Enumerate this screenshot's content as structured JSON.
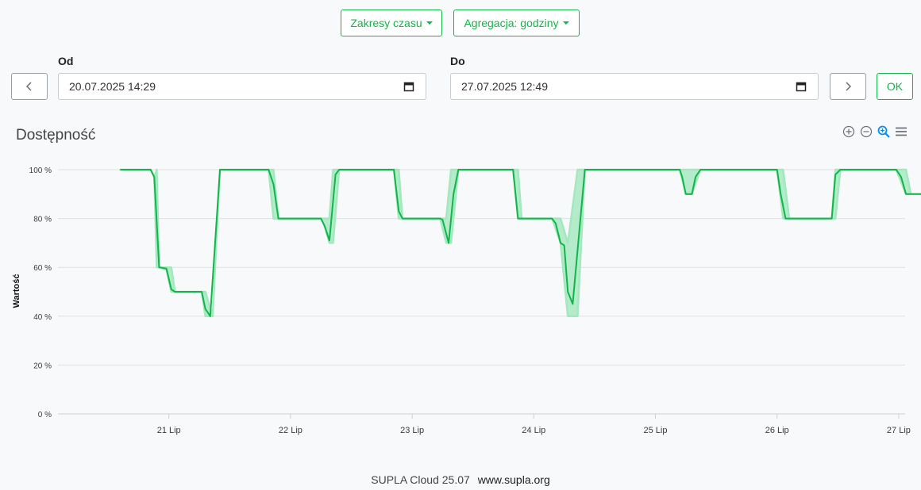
{
  "toolbar": {
    "time_ranges_label": "Zakresy czasu",
    "aggregation_label": "Agregacja: godziny"
  },
  "range": {
    "from_label": "Od",
    "from_value": "20.07.2025 14:29",
    "to_label": "Do",
    "to_value": "27.07.2025 12:49",
    "ok_label": "OK"
  },
  "chart": {
    "title": "Dostępność",
    "ylabel": "Wartość",
    "accent_color": "#12b54a",
    "band_color": "#a3e8bf"
  },
  "chart_data": {
    "type": "line",
    "title": "Dostępność",
    "xlabel": "",
    "ylabel": "Wartość",
    "x_ticks": [
      "21 Lip",
      "22 Lip",
      "23 Lip",
      "24 Lip",
      "25 Lip",
      "26 Lip",
      "27 Lip"
    ],
    "y_ticks": [
      "0 %",
      "20 %",
      "40 %",
      "60 %",
      "80 %",
      "100 %"
    ],
    "ylim": [
      0,
      100
    ],
    "x_unit": "days since 20 Lip 00:00",
    "series": [
      {
        "name": "",
        "points": [
          [
            0.6,
            100
          ],
          [
            0.85,
            100
          ],
          [
            0.88,
            97
          ],
          [
            0.92,
            60
          ],
          [
            0.98,
            59.5
          ],
          [
            1.02,
            51
          ],
          [
            1.05,
            50
          ],
          [
            1.27,
            50
          ],
          [
            1.3,
            43
          ],
          [
            1.34,
            40
          ],
          [
            1.42,
            100
          ],
          [
            1.82,
            100
          ],
          [
            1.86,
            94
          ],
          [
            1.9,
            80
          ],
          [
            2.25,
            80
          ],
          [
            2.28,
            77
          ],
          [
            2.32,
            71
          ],
          [
            2.37,
            98
          ],
          [
            2.4,
            100
          ],
          [
            2.85,
            100
          ],
          [
            2.89,
            83
          ],
          [
            2.92,
            80
          ],
          [
            3.23,
            80
          ],
          [
            3.25,
            79.5
          ],
          [
            3.3,
            70
          ],
          [
            3.34,
            90
          ],
          [
            3.38,
            100
          ],
          [
            3.83,
            100
          ],
          [
            3.87,
            80
          ],
          [
            4.15,
            80
          ],
          [
            4.18,
            78
          ],
          [
            4.22,
            70
          ],
          [
            4.25,
            69
          ],
          [
            4.28,
            50
          ],
          [
            4.32,
            45
          ],
          [
            4.36,
            67
          ],
          [
            4.42,
            100
          ],
          [
            5.2,
            100
          ],
          [
            5.22,
            97
          ],
          [
            5.25,
            90
          ],
          [
            5.3,
            90
          ],
          [
            5.33,
            97
          ],
          [
            5.37,
            100
          ],
          [
            6.0,
            100
          ],
          [
            6.03,
            90
          ],
          [
            6.07,
            80
          ],
          [
            6.45,
            80
          ],
          [
            6.48,
            98
          ],
          [
            6.52,
            100
          ],
          [
            6.98,
            100
          ],
          [
            7.02,
            97
          ],
          [
            7.06,
            90
          ],
          [
            7.45,
            90
          ],
          [
            7.49,
            82
          ],
          [
            7.53,
            80
          ],
          [
            7.58,
            80
          ]
        ],
        "band": [
          [
            0.6,
            100,
            100
          ],
          [
            0.85,
            100,
            100
          ],
          [
            0.88,
            97,
            97
          ],
          [
            0.9,
            60,
            100
          ],
          [
            0.92,
            60,
            60
          ],
          [
            0.98,
            59,
            60
          ],
          [
            1.02,
            50,
            60
          ],
          [
            1.05,
            50,
            50
          ],
          [
            1.27,
            50,
            50
          ],
          [
            1.3,
            40,
            50
          ],
          [
            1.36,
            40,
            40
          ],
          [
            1.42,
            100,
            100
          ],
          [
            1.82,
            100,
            100
          ],
          [
            1.86,
            80,
            100
          ],
          [
            1.9,
            80,
            80
          ],
          [
            2.25,
            80,
            80
          ],
          [
            2.28,
            77,
            80
          ],
          [
            2.32,
            70,
            80
          ],
          [
            2.35,
            70,
            100
          ],
          [
            2.4,
            100,
            100
          ],
          [
            2.85,
            100,
            100
          ],
          [
            2.89,
            80,
            100
          ],
          [
            2.92,
            80,
            80
          ],
          [
            3.23,
            80,
            80
          ],
          [
            3.28,
            70,
            80
          ],
          [
            3.32,
            70,
            100
          ],
          [
            3.38,
            100,
            100
          ],
          [
            3.83,
            100,
            100
          ],
          [
            3.87,
            80,
            100
          ],
          [
            3.9,
            80,
            80
          ],
          [
            4.15,
            80,
            80
          ],
          [
            4.22,
            70,
            80
          ],
          [
            4.28,
            40,
            70
          ],
          [
            4.36,
            40,
            100
          ],
          [
            4.42,
            100,
            100
          ],
          [
            5.2,
            100,
            100
          ],
          [
            5.25,
            90,
            100
          ],
          [
            5.3,
            90,
            100
          ],
          [
            5.37,
            100,
            100
          ],
          [
            6.0,
            100,
            100
          ],
          [
            6.05,
            80,
            100
          ],
          [
            6.1,
            80,
            80
          ],
          [
            6.45,
            80,
            80
          ],
          [
            6.48,
            80,
            100
          ],
          [
            6.52,
            100,
            100
          ],
          [
            6.98,
            100,
            100
          ],
          [
            7.06,
            90,
            100
          ],
          [
            7.1,
            90,
            90
          ],
          [
            7.45,
            90,
            90
          ],
          [
            7.5,
            80,
            90
          ],
          [
            7.58,
            80,
            80
          ]
        ]
      }
    ]
  },
  "footer": {
    "version": "SUPLA Cloud 25.07",
    "link": "www.supla.org"
  },
  "icons": {
    "zoom_in": "plus-circle-icon",
    "zoom_out": "minus-circle-icon",
    "zoom_select": "magnifier-icon",
    "menu": "hamburger-menu-icon",
    "prev": "chevron-left-icon",
    "next": "chevron-right-icon",
    "calendar": "calendar-icon"
  }
}
